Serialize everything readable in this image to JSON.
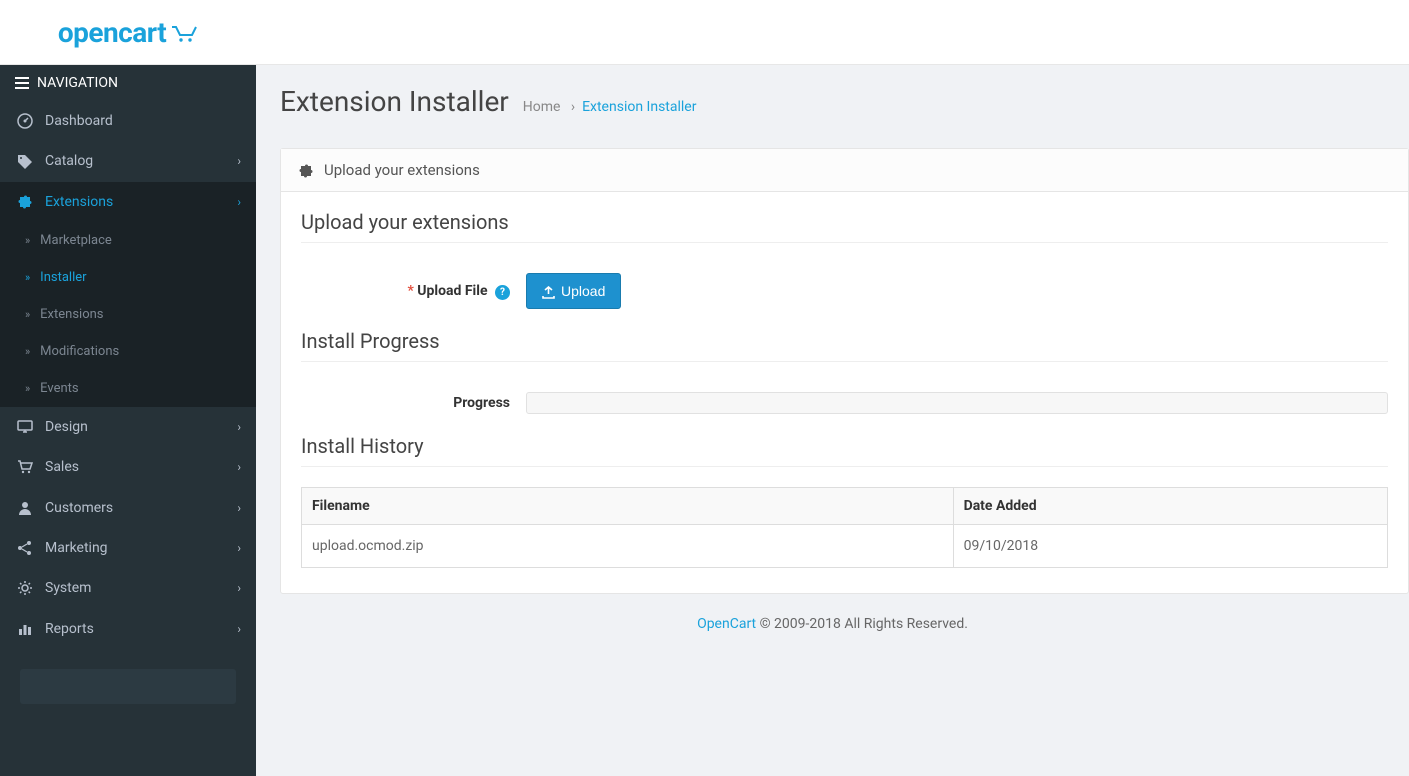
{
  "logo": "opencart",
  "nav_header": "NAVIGATION",
  "sidebar": {
    "dashboard": "Dashboard",
    "catalog": "Catalog",
    "extensions": "Extensions",
    "design": "Design",
    "sales": "Sales",
    "customers": "Customers",
    "marketing": "Marketing",
    "system": "System",
    "reports": "Reports",
    "sub": {
      "marketplace": "Marketplace",
      "installer": "Installer",
      "extensions": "Extensions",
      "modifications": "Modifications",
      "events": "Events"
    }
  },
  "page": {
    "title": "Extension Installer",
    "breadcrumb_home": "Home",
    "breadcrumb_sep": "›",
    "breadcrumb_current": "Extension Installer"
  },
  "panel": {
    "heading": "Upload your extensions",
    "section_upload": "Upload your extensions",
    "upload_file_label": "Upload File",
    "upload_btn": "Upload",
    "section_progress": "Install Progress",
    "progress_label": "Progress",
    "section_history": "Install History",
    "table": {
      "col_filename": "Filename",
      "col_date": "Date Added",
      "rows": [
        {
          "filename": "upload.ocmod.zip",
          "date": "09/10/2018"
        }
      ]
    }
  },
  "footer": {
    "link": "OpenCart",
    "text": " © 2009-2018 All Rights Reserved."
  }
}
